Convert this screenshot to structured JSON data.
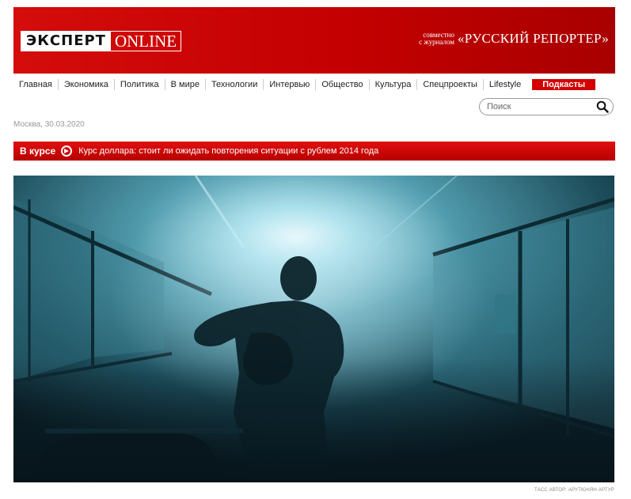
{
  "header": {
    "logo_main": "ЭКСПЕРТ",
    "logo_online": "ONLINE",
    "partner_line1": "совместно",
    "partner_line2": "с журналом",
    "partner_name": "«РУССКИЙ РЕПОРТЕР»"
  },
  "nav": {
    "items": [
      "Главная",
      "Экономика",
      "Политика",
      "В мире",
      "Технологии",
      "Интервью",
      "Общество",
      "Культура",
      "Спецпроекты",
      "Lifestyle"
    ],
    "highlight": "Подкасты"
  },
  "search": {
    "placeholder": "Поиск",
    "icon": "search-icon"
  },
  "date": "Москва, 30.03.2020",
  "ticker": {
    "label": "В курсе",
    "icon": "arrow-right-circle-icon",
    "headline": "Курс доллара: стоит ли ожидать повторения ситуации с рублем 2014 года"
  },
  "photo": {
    "credit": "ТАСС АВТОР: АРУТЮНЯН АРТУР"
  },
  "colors": {
    "brand_red": "#c40000",
    "text": "#222222",
    "muted": "#999999"
  }
}
